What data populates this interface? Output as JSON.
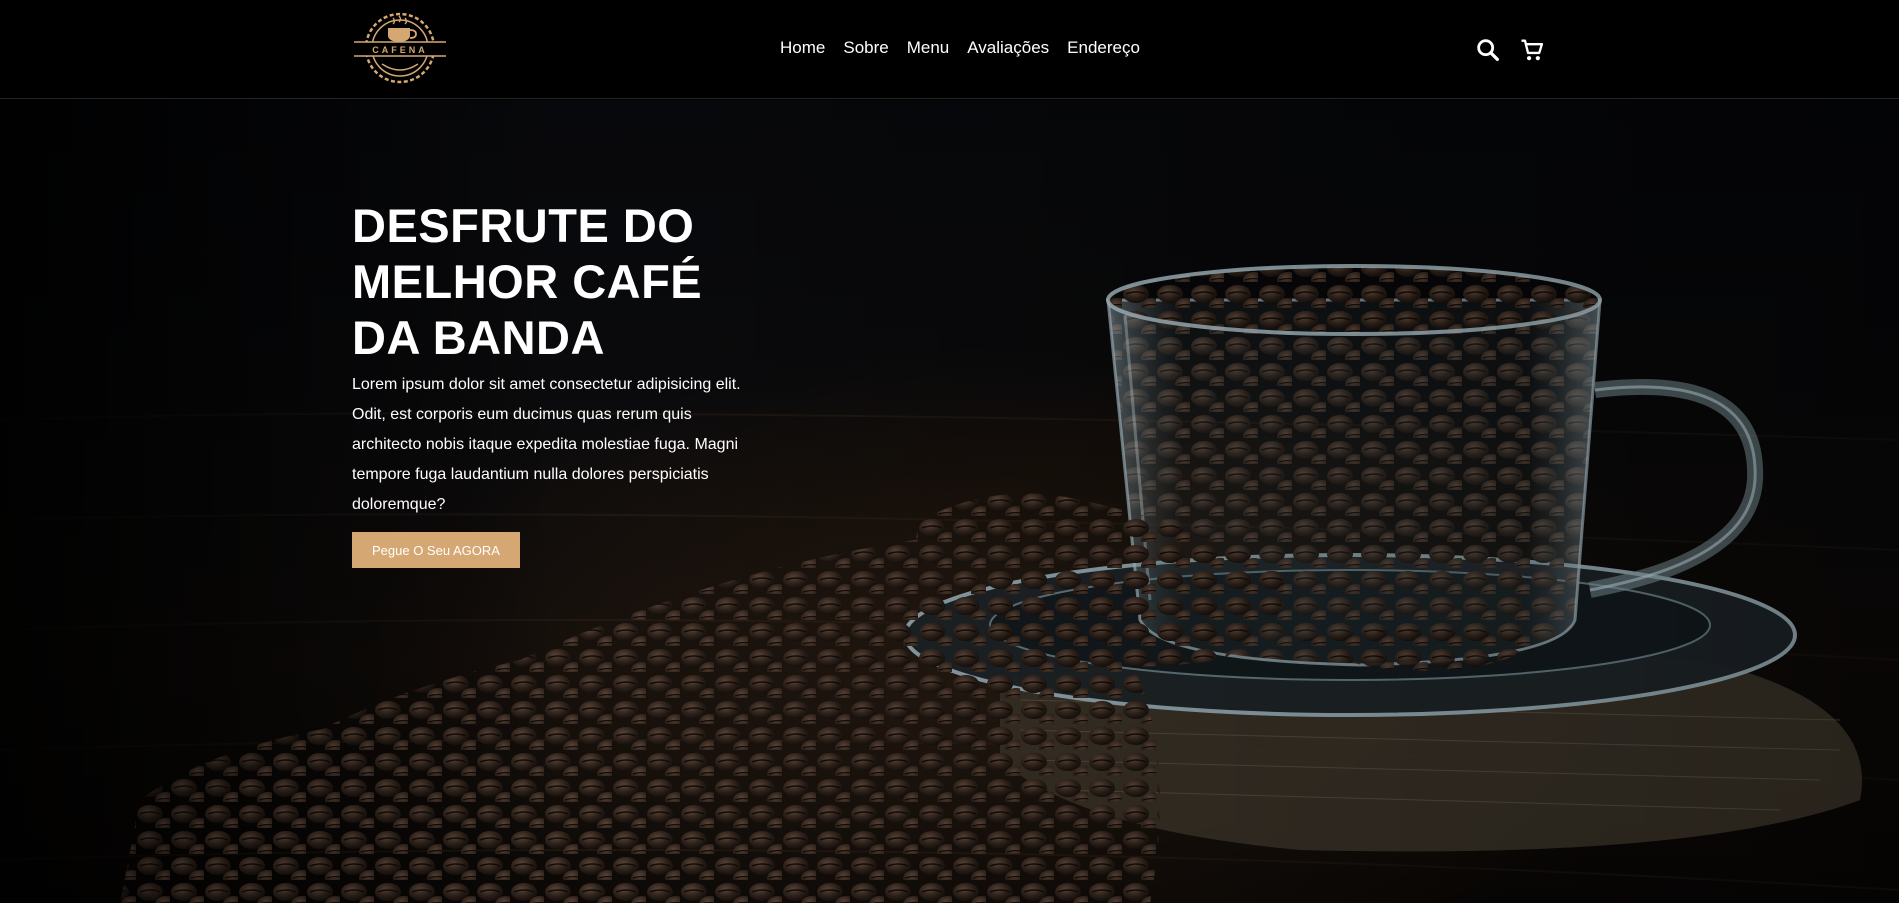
{
  "brand": {
    "logo_text": "CAFENA",
    "logo_color": "#d5a773"
  },
  "nav": {
    "items": [
      {
        "label": "Home"
      },
      {
        "label": "Sobre"
      },
      {
        "label": "Menu"
      },
      {
        "label": "Avaliações"
      },
      {
        "label": "Endereço"
      }
    ]
  },
  "header_icons": {
    "search": "search-icon",
    "cart": "cart-icon"
  },
  "hero": {
    "title": "DESFRUTE DO MELHOR CAFÉ DA BANDA",
    "text": "Lorem ipsum dolor sit amet consectetur adipisicing elit. Odit, est corporis eum ducimus quas rerum quis architecto nobis itaque expedita molestiae fuga. Magni tempore fuga laudantium nulla dolores perspiciatis doloremque?",
    "cta_label": "Pegue O Seu AGORA",
    "accent": "#d5a773"
  }
}
